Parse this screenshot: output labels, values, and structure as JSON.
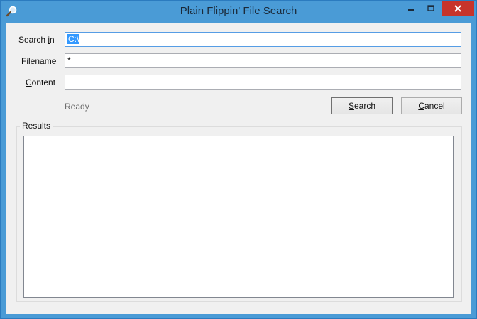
{
  "window": {
    "title": "Plain Flippin' File Search",
    "icon": "magnifier-icon",
    "close_color": "#c7342b",
    "frame_color": "#4a9bd6"
  },
  "form": {
    "search_in": {
      "label_pre": "Search ",
      "label_key": "i",
      "label_post": "n",
      "value": "C:\\"
    },
    "filename": {
      "label_pre": "",
      "label_key": "F",
      "label_post": "ilename",
      "value": "*"
    },
    "content": {
      "label_pre": "",
      "label_key": "C",
      "label_post": "ontent",
      "value": ""
    },
    "status": "Ready"
  },
  "buttons": {
    "search": {
      "key": "S",
      "rest": "earch"
    },
    "cancel": {
      "key": "C",
      "rest": "ancel"
    }
  },
  "results": {
    "label": "Results",
    "items": []
  }
}
